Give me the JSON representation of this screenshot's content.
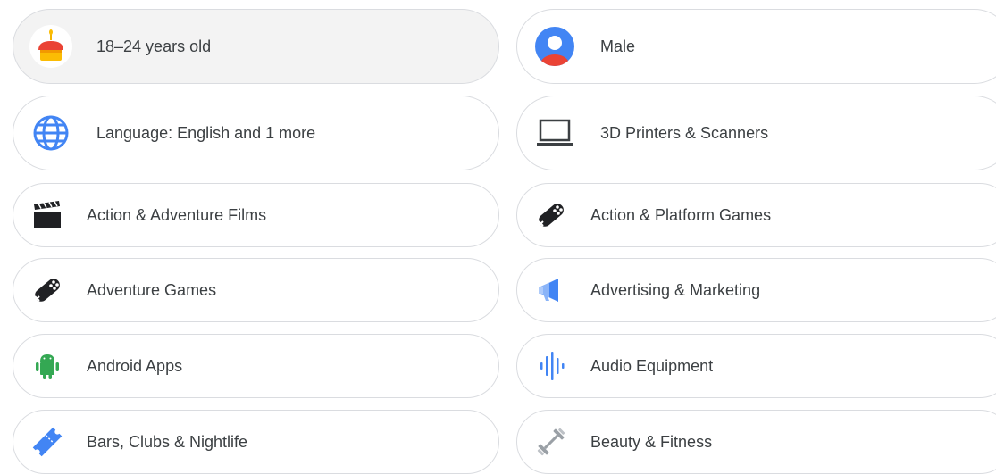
{
  "interests": [
    {
      "label": "18–24 years old",
      "icon": "birthday-cake-icon",
      "selected": true
    },
    {
      "label": "Male",
      "icon": "person-icon",
      "selected": false
    },
    {
      "label": "Language: English and 1 more",
      "icon": "globe-icon",
      "selected": false
    },
    {
      "label": "3D Printers & Scanners",
      "icon": "laptop-icon",
      "selected": false
    },
    {
      "label": "Action & Adventure Films",
      "icon": "clapperboard-icon",
      "selected": false
    },
    {
      "label": "Action & Platform Games",
      "icon": "gamepad-icon",
      "selected": false
    },
    {
      "label": "Adventure Games",
      "icon": "gamepad-icon",
      "selected": false
    },
    {
      "label": "Advertising & Marketing",
      "icon": "megaphone-icon",
      "selected": false
    },
    {
      "label": "Android Apps",
      "icon": "android-icon",
      "selected": false
    },
    {
      "label": "Audio Equipment",
      "icon": "audio-waveform-icon",
      "selected": false
    },
    {
      "label": "Bars, Clubs & Nightlife",
      "icon": "ticket-icon",
      "selected": false
    },
    {
      "label": "Beauty & Fitness",
      "icon": "dumbbell-icon",
      "selected": false
    }
  ],
  "colors": {
    "google_blue": "#4285f4",
    "google_red": "#ea4335",
    "google_yellow": "#fbbc04",
    "google_green": "#34a853",
    "icon_dark": "#3c4043",
    "chip_border": "#dadce0",
    "selected_bg": "#f3f3f3"
  }
}
